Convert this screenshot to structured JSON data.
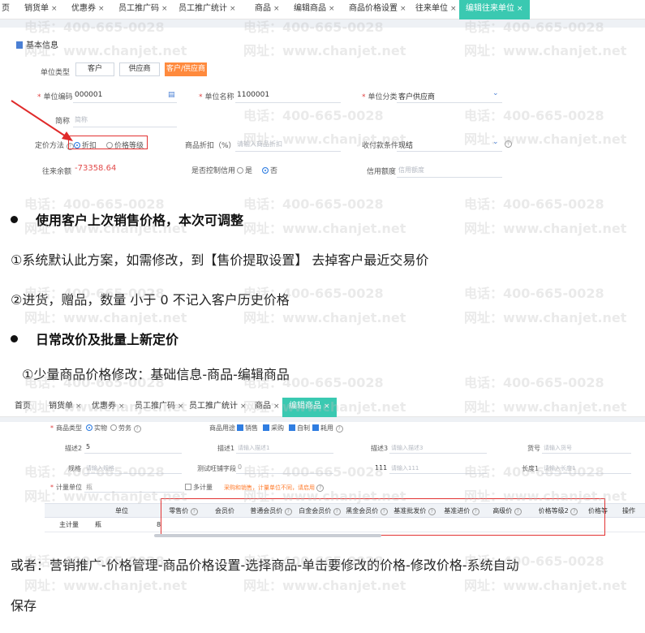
{
  "shot1": {
    "tabs": [
      {
        "label": "页",
        "close": ""
      },
      {
        "label": "销货单",
        "close": "×"
      },
      {
        "label": "优惠券",
        "close": "×"
      },
      {
        "label": "员工推广码",
        "close": "×"
      },
      {
        "label": "员工推广统计",
        "close": "×"
      },
      {
        "label": "商品",
        "close": "×"
      },
      {
        "label": "编辑商品",
        "close": "×"
      },
      {
        "label": "商品价格设置",
        "close": "×"
      },
      {
        "label": "往来单位",
        "close": "×"
      },
      {
        "label": "编辑往来单位",
        "close": "×"
      }
    ],
    "section_title": "基本信息",
    "unit_type_label": "单位类型",
    "unit_type_options": [
      "客户",
      "供应商",
      "客户/供应商"
    ],
    "code_label": "单位编码",
    "code_value": "000001",
    "name_label": "单位名称",
    "name_value": "1100001",
    "category_label": "单位分类",
    "category_value": "客户供应商",
    "abbr_label": "简称",
    "abbr_placeholder": "简称",
    "pricing_label": "定价方法",
    "pricing_options": [
      "折扣",
      "价格等级"
    ],
    "discount_label": "商品折扣（%）",
    "discount_placeholder": "请输入商品折扣",
    "payment_label": "收付款条件",
    "payment_value": "现结",
    "balance_label": "往来余额",
    "balance_value": "-73358.64",
    "credit_control_label": "是否控制信用",
    "credit_options": [
      "是",
      "否"
    ],
    "credit_limit_label": "信用额度",
    "credit_limit_placeholder": "信用额度",
    "help_symbol": "?"
  },
  "text": {
    "h1": "使用客户上次销售价格，本次可调整",
    "p1": "①系统默认此方案，如需修改，到【售价提取设置】 去掉客户最近交易价",
    "p2": "②进货，赠品，数量 小于 0     不记入客户历史价格",
    "h2": "日常改价及批量上新定价",
    "p3": "①少量商品价格修改：基础信息-商品-编辑商品",
    "p4": "或者：营销推广-价格管理-商品价格设置-选择商品-单击要修改的价格-修改价格-系统自动",
    "p5": "保存"
  },
  "shot2": {
    "tabs": [
      {
        "label": "首页",
        "close": ""
      },
      {
        "label": "销货单",
        "close": "×"
      },
      {
        "label": "优惠券",
        "close": "×"
      },
      {
        "label": "员工推广码",
        "close": "×"
      },
      {
        "label": "员工推广统计",
        "close": "×"
      },
      {
        "label": "商品",
        "close": "×"
      },
      {
        "label": "编辑商品",
        "close": "×"
      }
    ],
    "type_label": "商品类型",
    "type_options": [
      "实物",
      "劳务"
    ],
    "use_label": "商品用途",
    "use_options": [
      "销售",
      "采购",
      "自制",
      "耗用"
    ],
    "desc2_label": "描述2",
    "desc2_value": "5",
    "desc1_label": "描述1",
    "desc1_placeholder": "请输入描述1",
    "desc3_label": "描述3",
    "desc3_placeholder": "请输入描述3",
    "goods_no_label": "货号",
    "goods_no_placeholder": "请输入货号",
    "spec_label": "规格",
    "spec_placeholder": "请输入规格",
    "test_label": "测试旺铺字段",
    "test_value": "0",
    "f111_label": "111",
    "f111_placeholder": "请输入111",
    "length_label": "长度1",
    "length_placeholder": "请输入长度1",
    "unit_label": "计量单位",
    "unit_value": "瓶",
    "multi_unit_label": "多计量",
    "multi_unit_note": "采购和销售，计量单位不同，请启用",
    "table_headers": [
      "单位",
      "零售价",
      "会员价",
      "普通会员价",
      "白金会员价",
      "黑金会员价",
      "基准批发价",
      "基准进价",
      "高级价",
      "价格等级2",
      "价格等",
      "操作"
    ],
    "row": {
      "name": "主计量",
      "unit": "瓶",
      "cut": "8"
    },
    "help_symbol": "?"
  },
  "watermark": {
    "phone": "电话：400-665-0028",
    "site": "网址：www.chanjet.net"
  },
  "colors": {
    "accent_tab": "#3ac9b1",
    "selected_option": "#ff8a3d",
    "highlight_box": "#e23232",
    "negative": "#e24b4b"
  }
}
